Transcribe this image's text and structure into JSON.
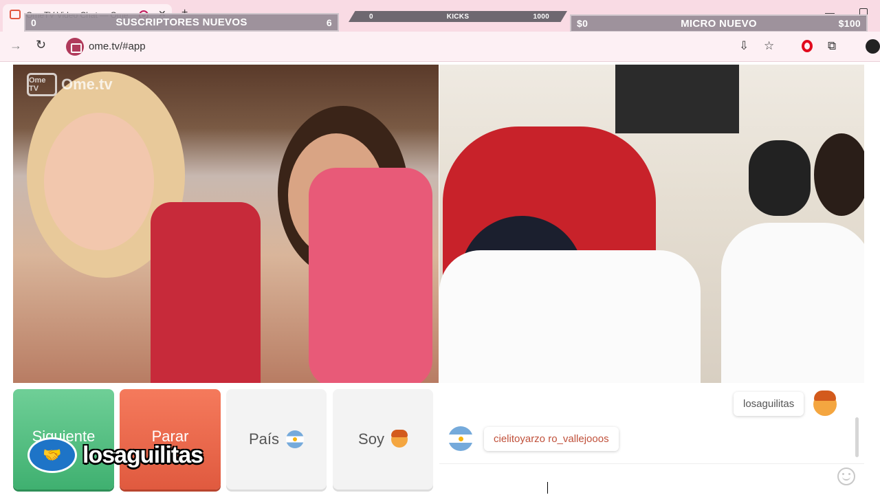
{
  "browser": {
    "tab_title": "OmeTV Video Chat — Ome",
    "url": "ome.tv/#app",
    "icons": [
      "back-icon",
      "reload-icon",
      "install-icon",
      "star-icon",
      "opera-icon",
      "extensions-icon",
      "profile-icon"
    ]
  },
  "overlays": {
    "subs": {
      "left": "0",
      "label": "SUSCRIPTORES NUEVOS",
      "right": "6"
    },
    "kicks": {
      "left": "0",
      "label": "KICKS",
      "right": "1000"
    },
    "micro": {
      "left": "$0",
      "label": "MICRO NUEVO",
      "right": "$100"
    }
  },
  "video": {
    "watermark": "Ome.tv",
    "watermark_tv": "Ome TV"
  },
  "controls": {
    "next_label": "Siguiente",
    "stop_label": "Parar",
    "country_label": "País",
    "gender_label": "Soy"
  },
  "streamer_badge": {
    "name": "losaguilitas"
  },
  "chat": {
    "self_message": "losaguilitas",
    "peer_message": "cielitoyarzo ro_vallejooos"
  },
  "colors": {
    "next": "#3fb070",
    "stop": "#e05a3f",
    "peer_text": "#c0503a"
  }
}
